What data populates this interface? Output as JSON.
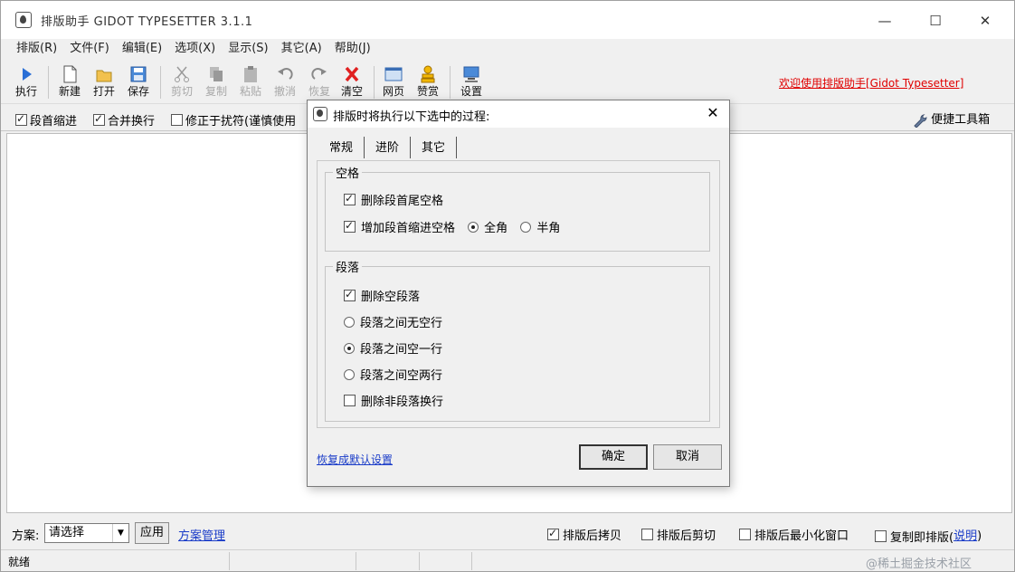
{
  "window": {
    "title": "排版助手 GIDOT TYPESETTER 3.1.1",
    "minimize": "—",
    "maximize": "☐",
    "close": "✕"
  },
  "menu": [
    "排版(R)",
    "文件(F)",
    "编辑(E)",
    "选项(X)",
    "显示(S)",
    "其它(A)",
    "帮助(J)"
  ],
  "toolbar": {
    "run": "执行",
    "new": "新建",
    "open": "打开",
    "save": "保存",
    "cut": "剪切",
    "copy": "复制",
    "paste": "粘贴",
    "undo": "撤消",
    "redo": "恢复",
    "clear": "清空",
    "web": "网页",
    "donate": "赞赏",
    "settings": "设置",
    "welcome": "欢迎使用排版助手[Gidot Typesetter]"
  },
  "options": {
    "indent": "段首缩进",
    "merge_lines": "合并换行",
    "fix_broken": "修正于扰符(谨慎使用",
    "tools": "便捷工具箱"
  },
  "dialog": {
    "title": "排版时将执行以下选中的过程:",
    "close": "✕",
    "tabs": [
      "常规",
      "进阶",
      "其它"
    ],
    "space_group": {
      "title": "空格",
      "trim_spaces": "删除段首尾空格",
      "add_indent": "增加段首缩进空格",
      "full_width": "全角",
      "half_width": "半角"
    },
    "para_group": {
      "title": "段落",
      "remove_empty": "删除空段落",
      "no_blank": "段落之间无空行",
      "one_blank": "段落之间空一行",
      "two_blank": "段落之间空两行",
      "remove_nonpara": "删除非段落换行"
    },
    "restore_default": "恢复成默认设置",
    "ok": "确定",
    "cancel": "取消"
  },
  "bottom": {
    "scheme_label": "方案:",
    "scheme_value": "请选择",
    "apply": "应用",
    "scheme_mgmt": "方案管理",
    "copy_after": "排版后拷贝",
    "cut_after": "排版后剪切",
    "minimize_after": "排版后最小化窗口",
    "copy_then_typeset": "复制即排版(",
    "help": "说明",
    "close_paren": ")"
  },
  "status": {
    "text": "就绪",
    "watermark": "@稀土掘金技术社区"
  }
}
